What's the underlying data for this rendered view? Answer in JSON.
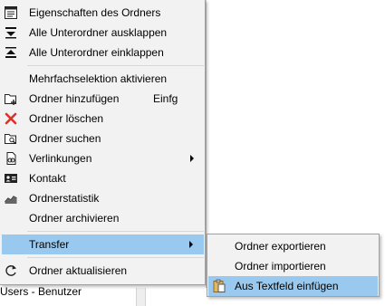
{
  "background": {
    "status_text": "Users - Benutzer"
  },
  "menu": {
    "items": [
      {
        "label": "Eigenschaften des Ordners",
        "icon": "properties-icon"
      },
      {
        "label": "Alle Unterordner ausklappen",
        "icon": "expand-all-icon"
      },
      {
        "label": "Alle Unterordner einklappen",
        "icon": "collapse-all-icon"
      },
      {
        "label": "Mehrfachselektion aktivieren",
        "icon": ""
      },
      {
        "label": "Ordner hinzufügen",
        "shortcut": "Einfg",
        "icon": "add-folder-icon"
      },
      {
        "label": "Ordner löschen",
        "icon": "delete-icon"
      },
      {
        "label": "Ordner suchen",
        "icon": "search-folder-icon"
      },
      {
        "label": "Verlinkungen",
        "icon": "links-icon",
        "has_submenu": true
      },
      {
        "label": "Kontakt",
        "icon": "contact-icon"
      },
      {
        "label": "Ordnerstatistik",
        "icon": "statistics-icon"
      },
      {
        "label": "Ordner archivieren",
        "icon": ""
      },
      {
        "label": "Transfer",
        "icon": "",
        "has_submenu": true,
        "highlighted": true
      },
      {
        "label": "Ordner aktualisieren",
        "icon": "refresh-icon"
      }
    ]
  },
  "submenu": {
    "items": [
      {
        "label": "Ordner exportieren",
        "icon": ""
      },
      {
        "label": "Ordner importieren",
        "icon": ""
      },
      {
        "label": "Aus Textfeld einfügen",
        "icon": "paste-icon",
        "highlighted": true
      }
    ]
  },
  "colors": {
    "menu_bg": "#f2f2f2",
    "highlight": "#99c9ef",
    "delete_red": "#d9342b"
  }
}
